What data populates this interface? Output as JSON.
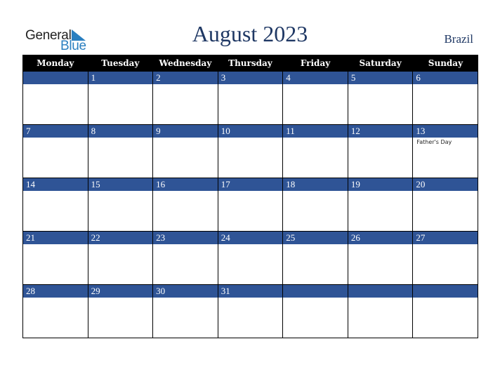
{
  "logo": {
    "general": "General",
    "blue": "Blue"
  },
  "header": {
    "title": "August 2023",
    "country": "Brazil"
  },
  "colors": {
    "band": "#2f5496",
    "title": "#1f3864",
    "logo_blue": "#2a7fc0",
    "header_bg": "#000000"
  },
  "weekdays": [
    "Monday",
    "Tuesday",
    "Wednesday",
    "Thursday",
    "Friday",
    "Saturday",
    "Sunday"
  ],
  "weeks": [
    {
      "days": [
        {
          "date": ""
        },
        {
          "date": "1"
        },
        {
          "date": "2"
        },
        {
          "date": "3"
        },
        {
          "date": "4"
        },
        {
          "date": "5"
        },
        {
          "date": "6"
        }
      ]
    },
    {
      "days": [
        {
          "date": "7"
        },
        {
          "date": "8"
        },
        {
          "date": "9"
        },
        {
          "date": "10"
        },
        {
          "date": "11"
        },
        {
          "date": "12"
        },
        {
          "date": "13",
          "event": "Father's Day"
        }
      ]
    },
    {
      "days": [
        {
          "date": "14"
        },
        {
          "date": "15"
        },
        {
          "date": "16"
        },
        {
          "date": "17"
        },
        {
          "date": "18"
        },
        {
          "date": "19"
        },
        {
          "date": "20"
        }
      ]
    },
    {
      "days": [
        {
          "date": "21"
        },
        {
          "date": "22"
        },
        {
          "date": "23"
        },
        {
          "date": "24"
        },
        {
          "date": "25"
        },
        {
          "date": "26"
        },
        {
          "date": "27"
        }
      ]
    },
    {
      "days": [
        {
          "date": "28"
        },
        {
          "date": "29"
        },
        {
          "date": "30"
        },
        {
          "date": "31"
        },
        {
          "date": ""
        },
        {
          "date": ""
        },
        {
          "date": ""
        }
      ]
    }
  ]
}
